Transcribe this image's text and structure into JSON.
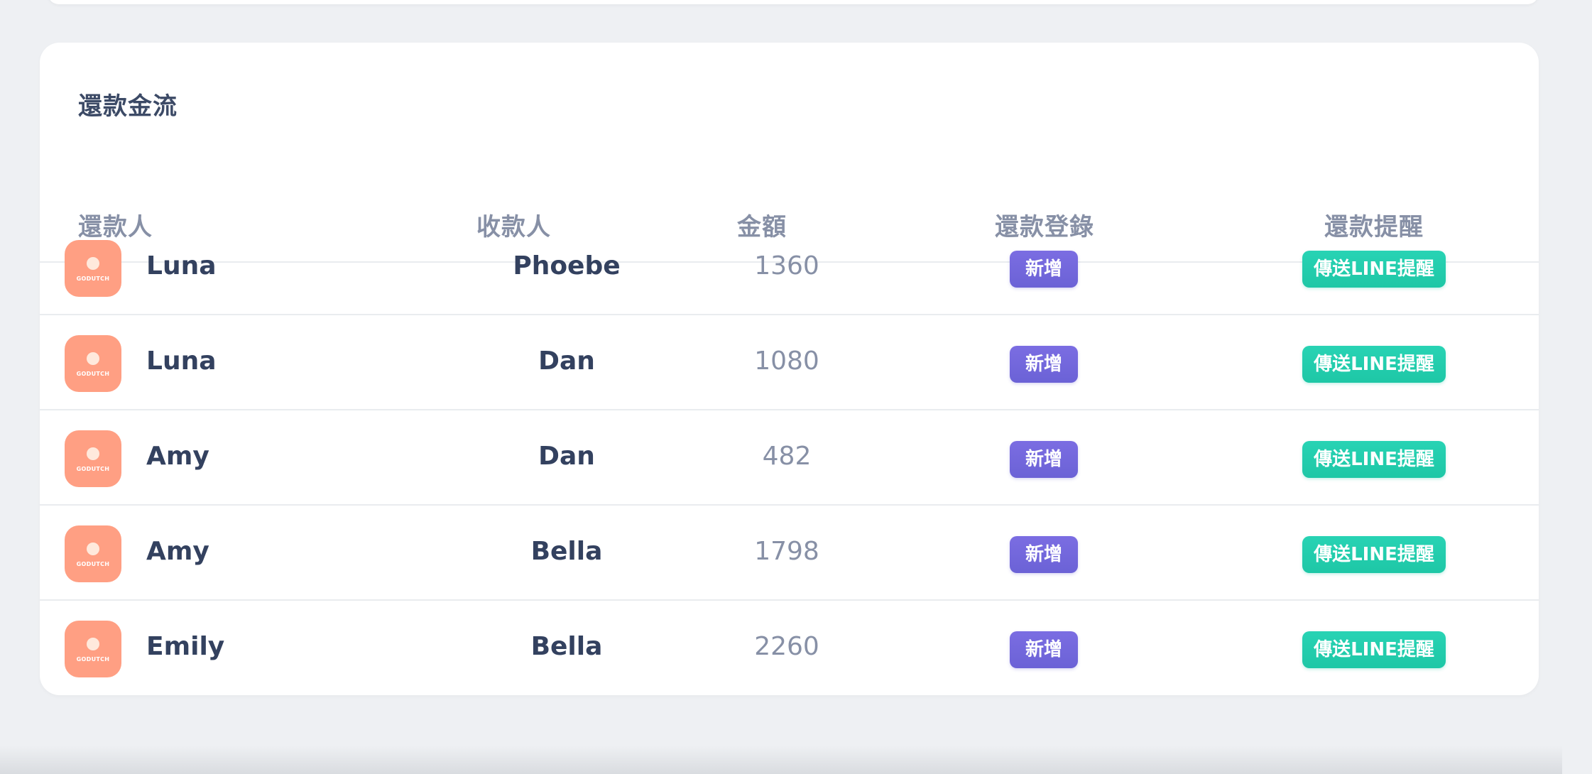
{
  "section": {
    "title": "還款金流"
  },
  "table": {
    "headers": {
      "payer": "還款人",
      "payee": "收款人",
      "amount": "金額",
      "record": "還款登錄",
      "remind": "還款提醒"
    },
    "avatar_label": "GODUTCH",
    "add_label": "新增",
    "line_label": "傳送LINE提醒",
    "rows": [
      {
        "payer": "Luna",
        "payee": "Phoebe",
        "amount": "1360"
      },
      {
        "payer": "Luna",
        "payee": "Dan",
        "amount": "1080"
      },
      {
        "payer": "Amy",
        "payee": "Dan",
        "amount": "482"
      },
      {
        "payer": "Amy",
        "payee": "Bella",
        "amount": "1798"
      },
      {
        "payer": "Emily",
        "payee": "Bella",
        "amount": "2260"
      }
    ]
  },
  "colors": {
    "avatar": "#ff9f83",
    "add_button": "#6b62d6",
    "line_button": "#1ec7a6",
    "text_primary": "#33415f",
    "text_muted": "#8790a6"
  }
}
